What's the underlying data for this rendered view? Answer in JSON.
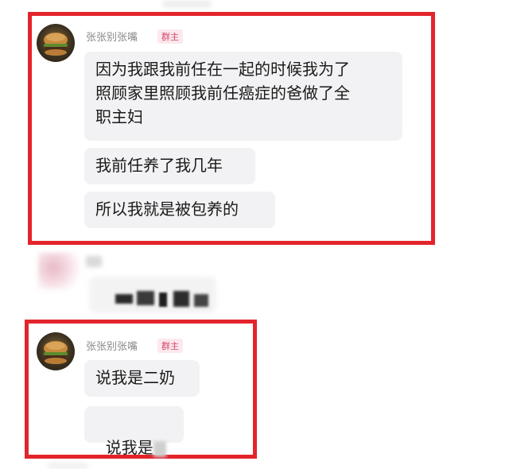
{
  "chat": {
    "messages_group_1": {
      "sender": "张张别张嘴",
      "role": "群主",
      "messages": [
        "因为我跟我前任在一起的时候我为了\n照顾家里照顾我前任癌症的爸做了全\n职主妇",
        "我前任养了我几年",
        "所以我就是被包养的"
      ]
    },
    "messages_group_2": {
      "sender": "张张别张嘴",
      "role": "群主",
      "messages": [
        "说我是二奶",
        "说我是"
      ]
    }
  },
  "colors": {
    "highlight_border": "#e3242b",
    "bubble_bg": "#f2f2f4",
    "badge_text": "#d04b6a",
    "badge_bg": "#fde8ee"
  },
  "icons": {
    "avatar": "burger-avatar-icon"
  }
}
